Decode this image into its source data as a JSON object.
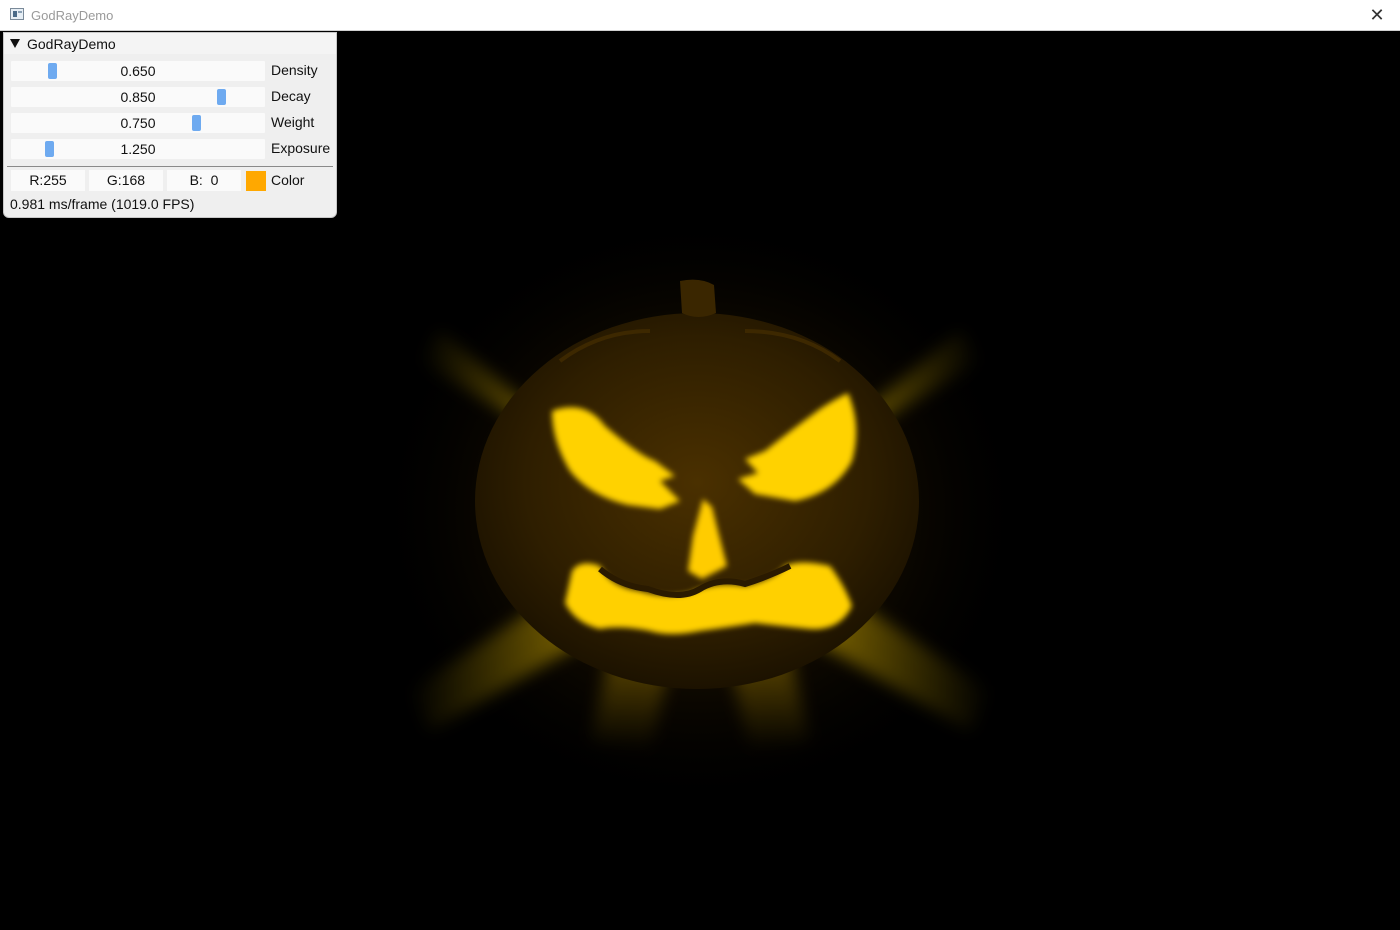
{
  "window": {
    "title": "GodRayDemo",
    "close_glyph": "✕"
  },
  "panel": {
    "header": "GodRayDemo",
    "sliders": [
      {
        "label": "Density",
        "value": "0.650",
        "grab_fraction": 0.15
      },
      {
        "label": "Decay",
        "value": "0.850",
        "grab_fraction": 0.84
      },
      {
        "label": "Weight",
        "value": "0.750",
        "grab_fraction": 0.74
      },
      {
        "label": "Exposure",
        "value": "1.250",
        "grab_fraction": 0.14
      }
    ],
    "color": {
      "r": "R:255",
      "g": "G:168",
      "b": "B:  0",
      "label": "Color",
      "swatch_hex": "#ffa800"
    },
    "fps_text": "0.981 ms/frame (1019.0 FPS)"
  },
  "scene": {
    "subject": "jack-o-lantern",
    "glow_color": "#ffd400",
    "body_color": "#2a1800"
  }
}
